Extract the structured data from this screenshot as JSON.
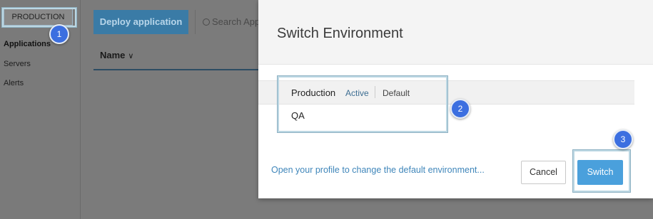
{
  "sidebar": {
    "environment_label": "PRODUCTION",
    "items": [
      {
        "label": "Applications",
        "active": true
      },
      {
        "label": "Servers",
        "active": false
      },
      {
        "label": "Alerts",
        "active": false
      }
    ]
  },
  "toolbar": {
    "deploy_label": "Deploy application",
    "search_placeholder": "Search Apps"
  },
  "table": {
    "column_name": "Name",
    "sort_indicator": "∨"
  },
  "modal": {
    "title": "Switch Environment",
    "environments": [
      {
        "name": "Production",
        "active_badge": "Active",
        "default_badge": "Default"
      },
      {
        "name": "QA"
      }
    ],
    "profile_link": "Open your profile to change the default environment...",
    "cancel_label": "Cancel",
    "switch_label": "Switch"
  },
  "callouts": [
    "1",
    "2",
    "3"
  ],
  "colors": {
    "primary_button": "#4aa0dc",
    "link": "#3f86ba",
    "callout": "#3c6fe0",
    "highlight": "#bcd7e3"
  }
}
